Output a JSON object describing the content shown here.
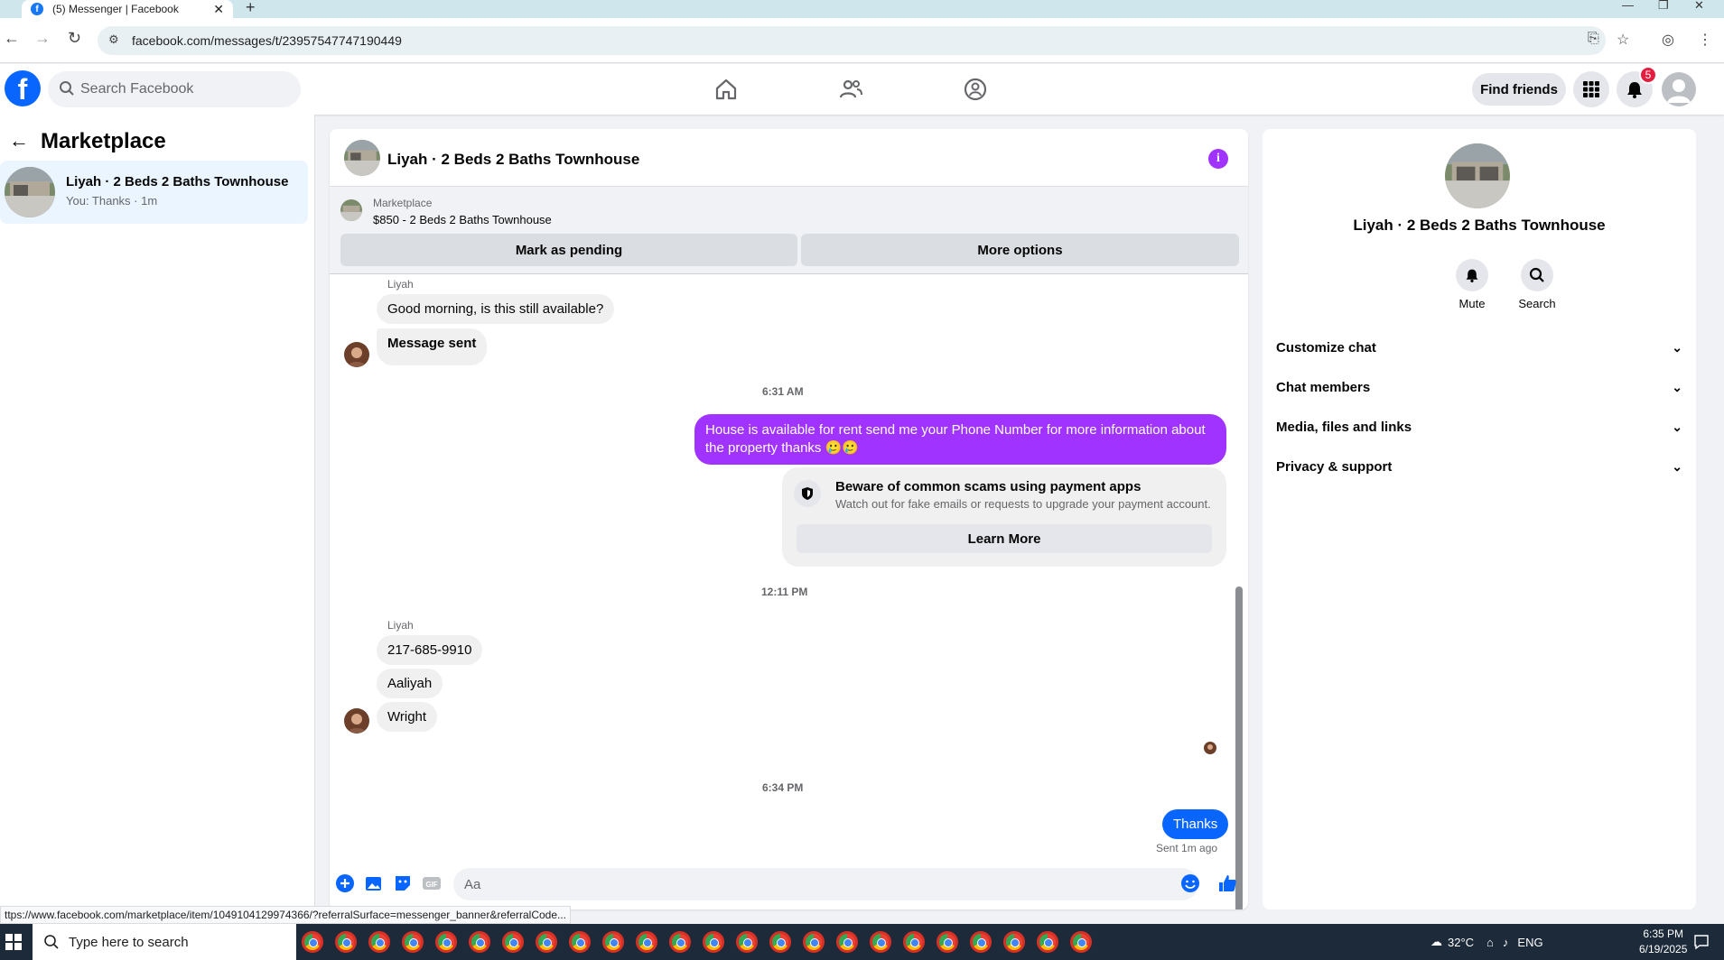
{
  "browser": {
    "tab_title": "(5) Messenger | Facebook",
    "url": "facebook.com/messages/t/23957547747190449",
    "status_url": "ttps://www.facebook.com/marketplace/item/1049104129974366/?referralSurface=messenger_banner&referralCode..."
  },
  "fb_header": {
    "search_placeholder": "Search Facebook",
    "find_friends": "Find friends",
    "notification_count": "5"
  },
  "left_panel": {
    "title": "Marketplace",
    "conversation": {
      "name": "Liyah · 2 Beds 2 Baths Townhouse",
      "preview": "You: Thanks · 1m"
    }
  },
  "chat": {
    "title": "Liyah · 2 Beds 2 Baths Townhouse",
    "marketplace_banner": {
      "label": "Marketplace",
      "listing": "$850 - 2 Beds 2 Baths Townhouse",
      "mark_pending": "Mark as pending",
      "more_options": "More options"
    },
    "messages": {
      "sender_1": "Liyah",
      "msg_1": "Good morning, is this still available?",
      "msg_2": "Message sent",
      "time_1": "6:31 AM",
      "out_1": "House is available for rent send me your Phone Number for more information about the property thanks 🥲🥲",
      "scam_title": "Beware of common scams using payment apps",
      "scam_sub": "Watch out for fake emails or requests to upgrade your payment account.",
      "learn_more": "Learn More",
      "time_2": "12:11 PM",
      "sender_2": "Liyah",
      "msg_3": "217-685-9910",
      "msg_4": "Aaliyah",
      "msg_5": "Wright",
      "time_3": "6:34 PM",
      "out_2": "Thanks",
      "sent_status": "Sent 1m ago"
    },
    "composer_placeholder": "Aa"
  },
  "right_panel": {
    "name": "Liyah · 2 Beds 2 Baths Townhouse",
    "mute": "Mute",
    "search": "Search",
    "sections": [
      "Customize chat",
      "Chat members",
      "Media, files and links",
      "Privacy & support"
    ]
  },
  "taskbar": {
    "search_placeholder": "Type here to search",
    "temperature": "32°C",
    "language": "ENG",
    "time": "6:35 PM",
    "date": "6/19/2025"
  },
  "colors": {
    "fb_blue": "#0866ff",
    "purple_bubble": "#a033ff",
    "incoming_bubble": "#f0f0f0",
    "selected_conv": "#ebf5ff"
  }
}
